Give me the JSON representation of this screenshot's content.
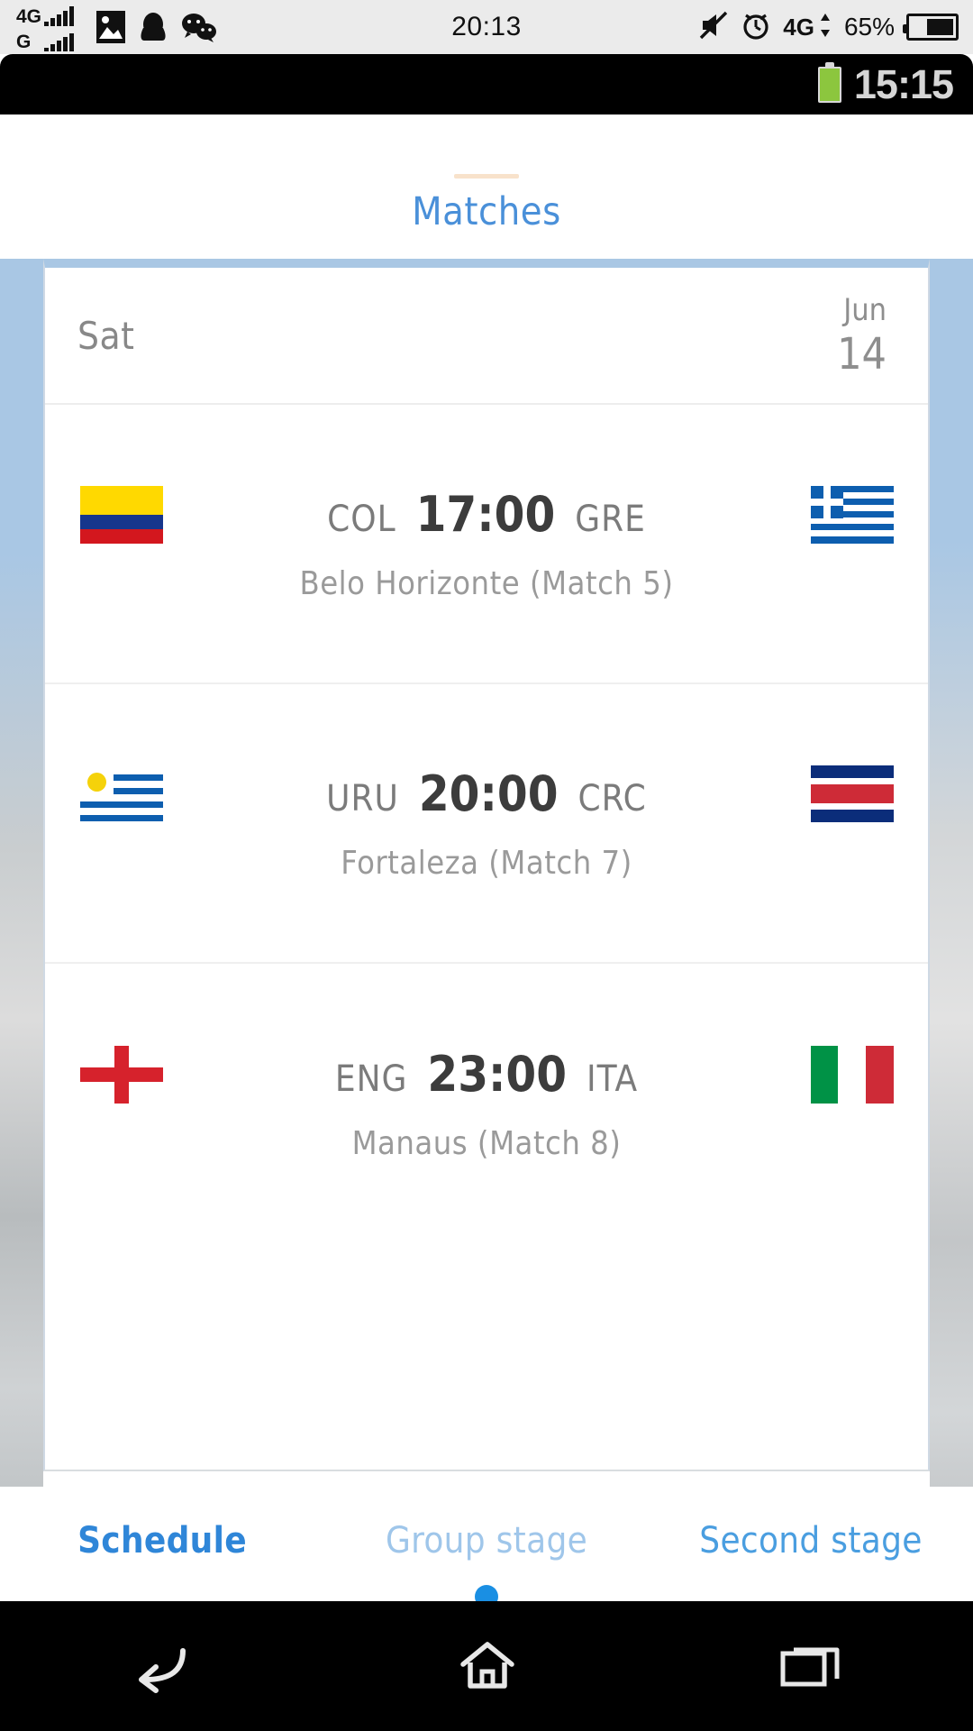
{
  "os_status_bar": {
    "network_primary": "4G",
    "network_secondary": "G",
    "clock": "20:13",
    "data_network": "4G",
    "battery_percent": "65%",
    "icons": [
      "gallery-icon",
      "qq-icon",
      "wechat-icon",
      "mute-icon",
      "alarm-icon",
      "data-transfer-icon",
      "battery-icon"
    ]
  },
  "inner_status_bar": {
    "clock": "15:15",
    "battery_icon": "battery-full-green-icon"
  },
  "header": {
    "title": "Matches",
    "title_color": "#4a90d9",
    "rule_color": "#f2cba0"
  },
  "schedule": {
    "date": {
      "day": "Sat",
      "month": "Jun",
      "number": "14"
    },
    "matches": [
      {
        "home_code": "COL",
        "away_code": "GRE",
        "kickoff": "17:00",
        "venue": "Belo Horizonte (Match  5)",
        "home_flag": "colombia-flag-icon",
        "away_flag": "greece-flag-icon"
      },
      {
        "home_code": "URU",
        "away_code": "CRC",
        "kickoff": "20:00",
        "venue": "Fortaleza (Match  7)",
        "home_flag": "uruguay-flag-icon",
        "away_flag": "costa-rica-flag-icon"
      },
      {
        "home_code": "ENG",
        "away_code": "ITA",
        "kickoff": "23:00",
        "venue": "Manaus (Match  8)",
        "home_flag": "england-flag-icon",
        "away_flag": "italy-flag-icon"
      }
    ]
  },
  "tabs": [
    {
      "label": "Schedule",
      "state": "active"
    },
    {
      "label": "Group stage",
      "state": "dim"
    },
    {
      "label": "Second stage",
      "state": "side"
    }
  ],
  "page_indicator_color": "#1a8fe3",
  "nav_bar": {
    "back": "back-icon",
    "home": "home-icon",
    "recents": "recents-icon"
  }
}
